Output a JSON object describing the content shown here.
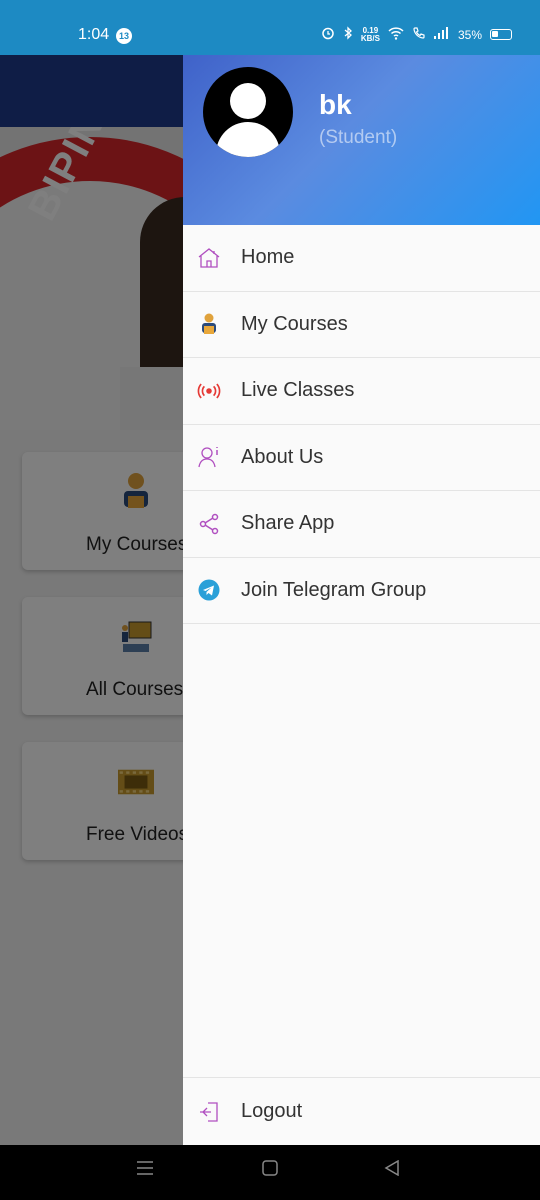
{
  "status_bar": {
    "time": "1:04",
    "notification_count": "13",
    "net_speed_value": "0.19",
    "net_speed_unit": "KB/S",
    "battery": "35%"
  },
  "home": {
    "banner_text": "BIPIN",
    "cards": [
      {
        "label": "My Courses",
        "icon": "student-icon"
      },
      {
        "label": "All Courses",
        "icon": "teacher-board-icon"
      },
      {
        "label": "Free Videos",
        "icon": "film-strip-icon"
      }
    ]
  },
  "drawer": {
    "user_name": "bk",
    "user_role": "(Student)",
    "menu": [
      {
        "label": "Home",
        "icon": "home-icon"
      },
      {
        "label": "My Courses",
        "icon": "student-icon"
      },
      {
        "label": "Live Classes",
        "icon": "broadcast-icon"
      },
      {
        "label": "About Us",
        "icon": "info-person-icon"
      },
      {
        "label": "Share App",
        "icon": "share-icon"
      },
      {
        "label": "Join Telegram Group",
        "icon": "telegram-icon"
      }
    ],
    "logout_label": "Logout"
  },
  "colors": {
    "status_bar": "#1d8ac3",
    "header_gradient_start": "#3f62c9",
    "header_gradient_end": "#2196f3",
    "menu_icon_purple": "#b04fc0",
    "live_red": "#e53935",
    "telegram_blue": "#2aa0d8"
  }
}
